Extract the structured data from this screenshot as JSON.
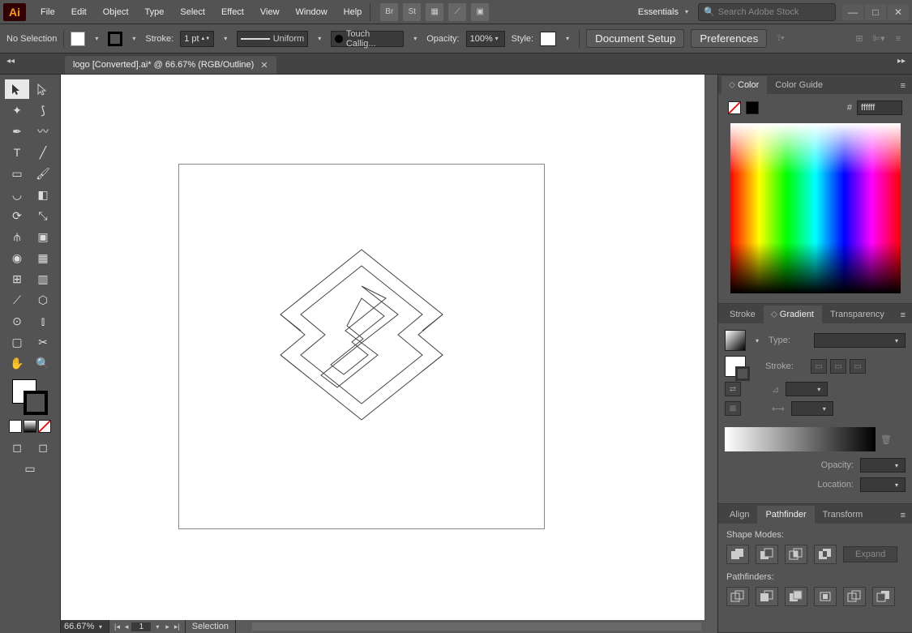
{
  "menubar": {
    "items": [
      "File",
      "Edit",
      "Object",
      "Type",
      "Select",
      "Effect",
      "View",
      "Window",
      "Help"
    ],
    "workspace": "Essentials",
    "search_placeholder": "Search Adobe Stock"
  },
  "controlbar": {
    "selection_label": "No Selection",
    "stroke_label": "Stroke:",
    "stroke_value": "1 pt",
    "uniform": "Uniform",
    "brush": "Touch Callig...",
    "opacity_label": "Opacity:",
    "opacity_value": "100%",
    "style_label": "Style:",
    "doc_setup": "Document Setup",
    "prefs": "Preferences"
  },
  "tab": {
    "title": "logo [Converted].ai* @ 66.67% (RGB/Outline)"
  },
  "status": {
    "zoom": "66.67%",
    "page": "1",
    "tool": "Selection"
  },
  "panels": {
    "color": {
      "tabs": [
        "Color",
        "Color Guide"
      ],
      "hex": "ffffff",
      "hash": "#"
    },
    "gradient": {
      "tabs": [
        "Stroke",
        "Gradient",
        "Transparency"
      ],
      "type_label": "Type:",
      "stroke_label": "Stroke:",
      "opacity_label": "Opacity:",
      "location_label": "Location:"
    },
    "pathfinder": {
      "tabs": [
        "Align",
        "Pathfinder",
        "Transform"
      ],
      "shape_modes": "Shape Modes:",
      "pathfinders": "Pathfinders:",
      "expand": "Expand"
    }
  }
}
